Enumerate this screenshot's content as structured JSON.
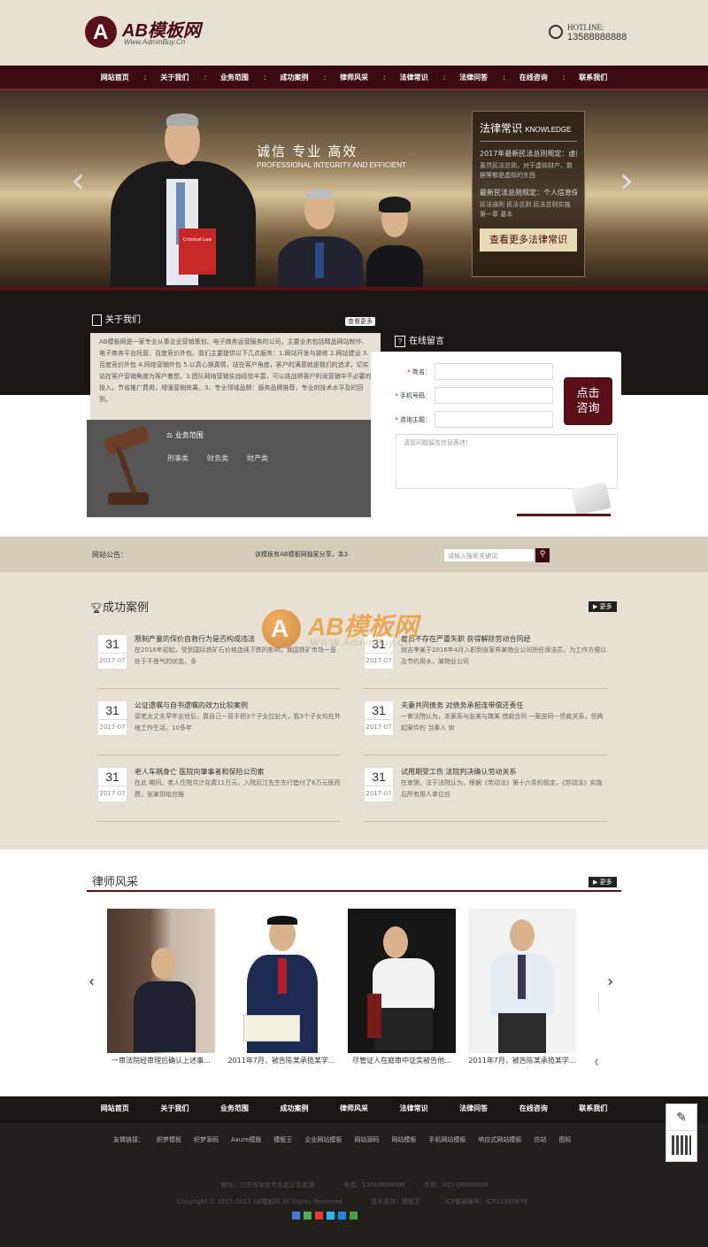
{
  "header": {
    "logo_letter": "A",
    "logo_text": "AB模板网",
    "logo_sub": "Www.AdminBuy.Cn",
    "hotline_label": "HOTLINE:",
    "hotline_number": "13588888888"
  },
  "nav": [
    "网站首页",
    "关于我们",
    "业务范围",
    "成功案例",
    "律师风采",
    "法律常识",
    "法律问答",
    "在线咨询",
    "联系我们"
  ],
  "banner": {
    "slogan": "诚信 专业 高效",
    "slogan_en": "PROFESSIONAL INTEGRITY AND EFFICIENT",
    "book": "Criminal Law",
    "knowledge_title": "法律常识",
    "knowledge_en": "KNOWLEDGE",
    "items": [
      {
        "title": "2017年最新民法总则规定：虚拟财",
        "desc": "虽然民法总则，对于虚拟财产、数据等都是虚拟的东西"
      },
      {
        "title": "最新民法总则规定：个人信息保护",
        "desc": "民法通则 民法总则 民法总则实施 第一章 基本"
      }
    ],
    "knowledge_button": "查看更多法律常识"
  },
  "about": {
    "title": "关于我们",
    "more": "查看更多",
    "text": "AB模板网是一家专业从事企业营销策划、电子商务运营服务的公司，主要业务包括精品网站制作、电子商务平台托管、百度竞价外包、我们主要提供以下几点服务：1.网站开发与装修 2.网站建设 3.百度竞价外包 4.网络营销外包 5.以真心换真情，站在客户角度，客户的满意就是我们的追求，切实站在客户营销角度为客户着想。3.团队网络营销实战经验丰富，可以挑战将客户利润营销中不必要的投入，节省推广费用，增强营销效果。3、专业领域品牌：服务品牌推荐，专业的技术水平及时回到。",
    "biz_title": "业务范围",
    "biz_items": [
      "刑事类",
      "财务类",
      "財产类"
    ]
  },
  "message": {
    "title": "在线留言",
    "fields": [
      {
        "label": "姓名：",
        "required": "*"
      },
      {
        "label": "手机号码：",
        "required": "*"
      },
      {
        "label": "咨询主题：",
        "required": "*"
      }
    ],
    "submit_line1": "点击",
    "submit_line2": "咨询",
    "textarea_placeholder": "请您问题留言信息表述!"
  },
  "notice": {
    "label": "网站公告：",
    "text": "该模板有AB模板网独家分享，本3",
    "search_placeholder": "请输入搜索关键词"
  },
  "cases": {
    "title": "成功案例",
    "more": "更多",
    "items": [
      {
        "day": "31",
        "ym": "2017-07",
        "title": "限制产量的保价自救行为是否构成违法",
        "desc": "在2016年初起，受到国际铁矿石价格连续下跌的影响，我国铁矿市场一直处于不景气的状态，多"
      },
      {
        "day": "31",
        "ym": "2017-07",
        "title": "雇员不存在严重失职 获得解除劳动合同经",
        "desc": "就吉李某于2016年4月入职到张家界某物业公司担任保洁员，为工作方便以及节约用水，某物业公司"
      },
      {
        "day": "31",
        "ym": "2017-07",
        "title": "公证遗嘱与自书遗嘱的效力比较案例",
        "desc": "梁老太丈夫早年去世后，靠自己一双手把3个子女拉扯大，我3个子女均在外地工作生活，10多年"
      },
      {
        "day": "31",
        "ym": "2017-07",
        "title": "夫妻共同债务 对债务承担连带偿还责任",
        "desc": "一审法院认为，本案系与张某与魏某 借款合同 一案是同一债款关系，但两起案件的 当事人 如"
      },
      {
        "day": "31",
        "ym": "2017-07",
        "title": "老人车祸身亡 医院向肇事者和保险公司索",
        "desc": "在此 期间，老人住院共计花费11万元，入院后江先生先行垫付了6万元医药费，张某供给应赔"
      },
      {
        "day": "31",
        "ym": "2017-07",
        "title": "试用期受工伤 法院判决确认劳动关系",
        "desc": "在审理，法于法院认为，根据《劳动法》第十六条的规定，《劳动法》实施后所有用人单位应"
      }
    ]
  },
  "watermark": {
    "letter": "A",
    "text": "AB模板网",
    "sub": "WWW.AdminBuy.Cn"
  },
  "lawyers": {
    "title": "律师风采",
    "more": "更多",
    "items": [
      "一审法院经审理后确认上述事...",
      "2011年7月，被告陈某承揽某学...",
      "尽管证人在庭审中证实被告他...",
      "2011年7月，被告陈某承揽某学...",
      "《"
    ]
  },
  "footer": {
    "nav": [
      "网站首页",
      "关于我们",
      "业务范围",
      "成功案例",
      "律师风采",
      "法律常识",
      "法律问答",
      "在线咨询",
      "联系我们"
    ],
    "links_label": "友情链接：",
    "links": [
      "织梦模板",
      "织梦源码",
      "Axure模版",
      "模板王",
      "企业网站模板",
      "网站源码",
      "网站模板",
      "手机网站模板",
      "响应式网站模板",
      "仿站",
      "图标"
    ],
    "address": "地址：江苏省南京市玄武区玄武湖",
    "phone": "电话：13588888888",
    "fax": "传真：010-88888888",
    "copyright": "Copyright © 2015-2017 AB模板网 All Rights Reserved",
    "tech": "技术支持：模板王",
    "icp": "ICP备案编号：ICP12345678"
  },
  "colors": {
    "brand": "#5a1018",
    "nav_bg": "#3c0a12",
    "beige": "#e8e1d3"
  }
}
